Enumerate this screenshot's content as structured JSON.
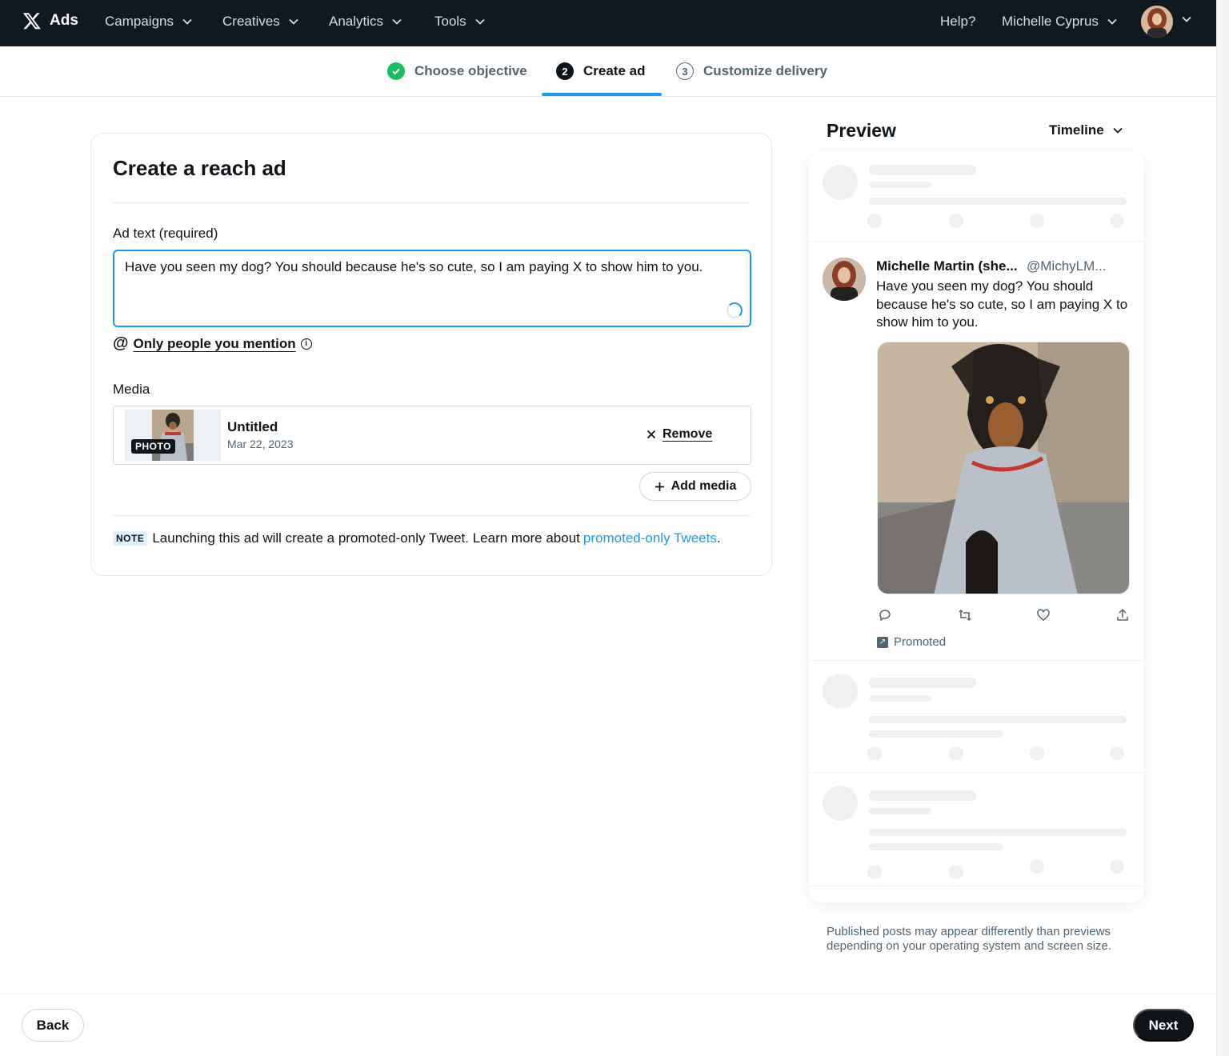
{
  "topnav": {
    "brand": "Ads",
    "menus": [
      {
        "label": "Campaigns"
      },
      {
        "label": "Creatives"
      },
      {
        "label": "Analytics"
      },
      {
        "label": "Tools"
      }
    ],
    "help": "Help?",
    "account": "Michelle Cyprus"
  },
  "stepper": {
    "steps": [
      {
        "label": "Choose objective",
        "state": "done",
        "number": ""
      },
      {
        "label": "Create ad",
        "state": "active",
        "number": "2"
      },
      {
        "label": "Customize delivery",
        "state": "todo",
        "number": "3"
      }
    ]
  },
  "form": {
    "title": "Create a reach ad",
    "ad_text_label": "Ad text",
    "ad_text_required": "(required)",
    "ad_text_value": "Have you seen my dog? You should because he's so cute, so I am paying X to show him to you.",
    "mention_at": "@",
    "mention_label": "Only people you mention",
    "mention_info": "i",
    "media_label": "Media",
    "media_item": {
      "tag": "PHOTO",
      "title": "Untitled",
      "date": "Mar 22, 2023",
      "remove_label": "Remove"
    },
    "add_media_label": "Add media",
    "note_tag": "NOTE",
    "note_text": "Launching this ad will create a promoted-only Tweet. Learn more about",
    "note_link": "promoted-only Tweets",
    "note_end": "."
  },
  "preview": {
    "title": "Preview",
    "placement": "Timeline",
    "tweet": {
      "name": "Michelle Martin (she...",
      "handle": "@MichyLM...",
      "text": "Have you seen my dog? You should because he's so cute, so I am paying X to show him to you.",
      "promoted_label": "Promoted"
    },
    "disclaimer": "Published posts may appear differently than previews depending on your operating system and screen size."
  },
  "footer": {
    "back_label": "Back",
    "next_label": "Next"
  },
  "colors": {
    "nav_bg": "#101820",
    "accent": "#1d9bf0",
    "success": "#17bf63",
    "primary_button": "#0f1419"
  }
}
